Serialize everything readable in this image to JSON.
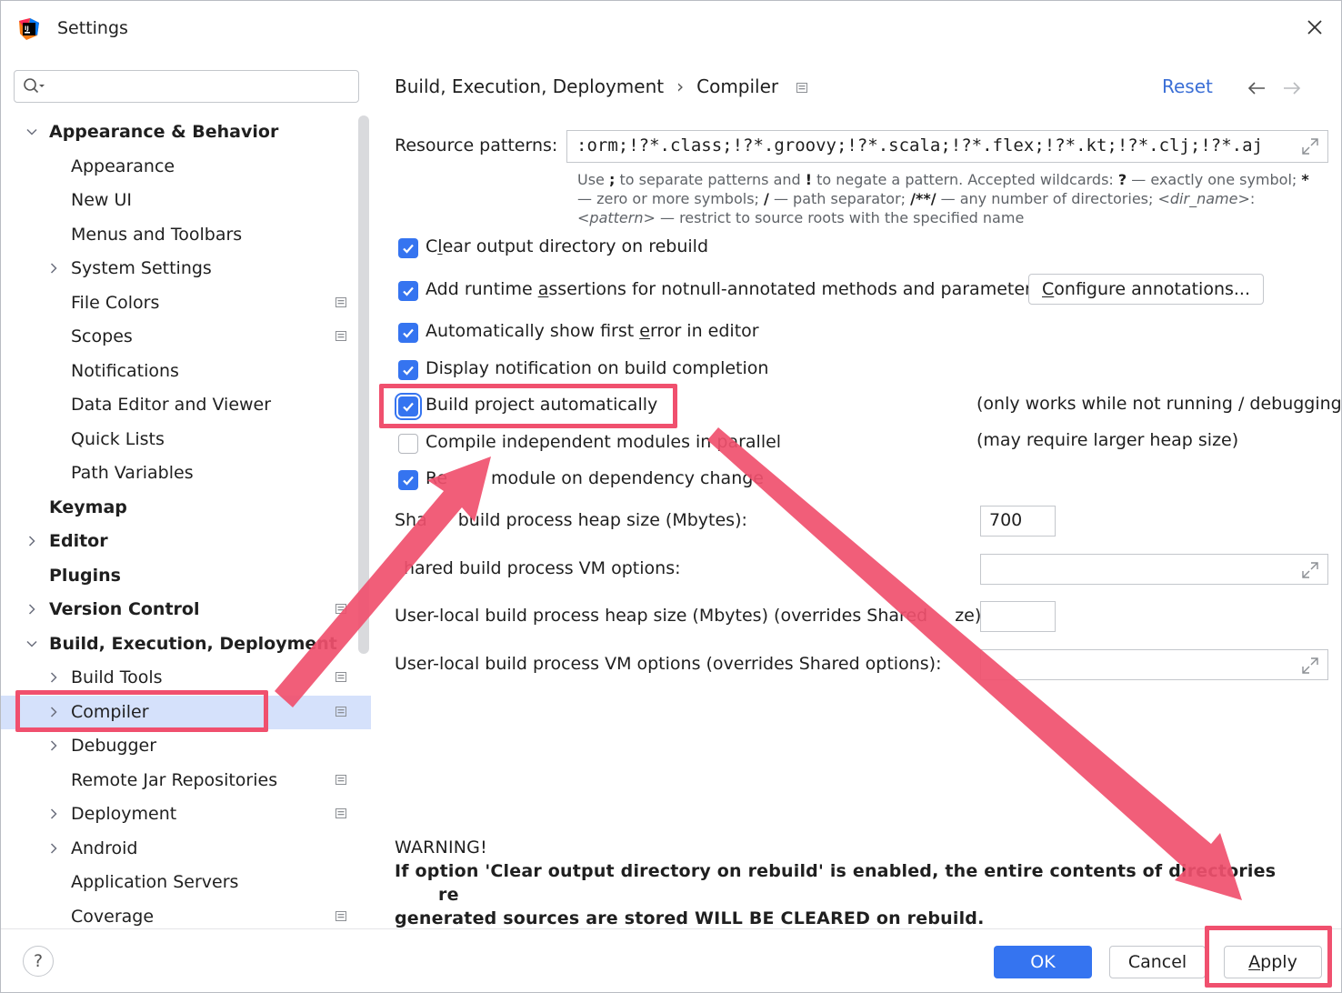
{
  "window": {
    "title": "Settings"
  },
  "search": {
    "placeholder": ""
  },
  "sidebar": {
    "items": [
      {
        "label": "Appearance & Behavior",
        "bold": true,
        "chevron": "down",
        "indent": 0,
        "project": false
      },
      {
        "label": "Appearance",
        "bold": false,
        "chevron": "none",
        "indent": 1,
        "project": false
      },
      {
        "label": "New UI",
        "bold": false,
        "chevron": "none",
        "indent": 1,
        "project": false
      },
      {
        "label": "Menus and Toolbars",
        "bold": false,
        "chevron": "none",
        "indent": 1,
        "project": false
      },
      {
        "label": "System Settings",
        "bold": false,
        "chevron": "right",
        "indent": 1,
        "project": false
      },
      {
        "label": "File Colors",
        "bold": false,
        "chevron": "none",
        "indent": 1,
        "project": true
      },
      {
        "label": "Scopes",
        "bold": false,
        "chevron": "none",
        "indent": 1,
        "project": true
      },
      {
        "label": "Notifications",
        "bold": false,
        "chevron": "none",
        "indent": 1,
        "project": false
      },
      {
        "label": "Data Editor and Viewer",
        "bold": false,
        "chevron": "none",
        "indent": 1,
        "project": false
      },
      {
        "label": "Quick Lists",
        "bold": false,
        "chevron": "none",
        "indent": 1,
        "project": false
      },
      {
        "label": "Path Variables",
        "bold": false,
        "chevron": "none",
        "indent": 1,
        "project": false
      },
      {
        "label": "Keymap",
        "bold": true,
        "chevron": "none",
        "indent": 0,
        "project": false
      },
      {
        "label": "Editor",
        "bold": true,
        "chevron": "right",
        "indent": 0,
        "project": false
      },
      {
        "label": "Plugins",
        "bold": true,
        "chevron": "none",
        "indent": 0,
        "project": false
      },
      {
        "label": "Version Control",
        "bold": true,
        "chevron": "right",
        "indent": 0,
        "project": true
      },
      {
        "label": "Build, Execution, Deployment",
        "bold": true,
        "chevron": "down",
        "indent": 0,
        "project": false
      },
      {
        "label": "Build Tools",
        "bold": false,
        "chevron": "right",
        "indent": 1,
        "project": true
      },
      {
        "label": "Compiler",
        "bold": false,
        "chevron": "right",
        "indent": 1,
        "project": true,
        "selected": true
      },
      {
        "label": "Debugger",
        "bold": false,
        "chevron": "right",
        "indent": 1,
        "project": false
      },
      {
        "label": "Remote Jar Repositories",
        "bold": false,
        "chevron": "none",
        "indent": 1,
        "project": true
      },
      {
        "label": "Deployment",
        "bold": false,
        "chevron": "right",
        "indent": 1,
        "project": true
      },
      {
        "label": "Android",
        "bold": false,
        "chevron": "right",
        "indent": 1,
        "project": false
      },
      {
        "label": "Application Servers",
        "bold": false,
        "chevron": "none",
        "indent": 1,
        "project": false
      },
      {
        "label": "Coverage",
        "bold": false,
        "chevron": "none",
        "indent": 1,
        "project": true
      }
    ]
  },
  "breadcrumb": {
    "parent": "Build, Execution, Deployment",
    "sep": "›",
    "current": "Compiler"
  },
  "header": {
    "reset": "Reset"
  },
  "resource": {
    "label": "Resource patterns:",
    "value": ":orm;!?*.class;!?*.groovy;!?*.scala;!?*.flex;!?*.kt;!?*.clj;!?*.aj",
    "hint_1": "Use ",
    "hint_2": ";",
    "hint_3": " to separate patterns and ",
    "hint_4": "!",
    "hint_5": " to negate a pattern. Accepted wildcards: ",
    "hint_6": "?",
    "hint_7": " — exactly one symbol; ",
    "hint_8": "*",
    "hint_9": " — zero or more symbols; ",
    "hint_10": "/",
    "hint_11": " — path separator; ",
    "hint_12": "/**/",
    "hint_13": " — any number of directories; ",
    "hint_14": "<dir_name>",
    "hint_15": ":",
    "hint_16": "<pattern>",
    "hint_17": " — restrict to source roots with the specified name"
  },
  "options": {
    "clear_output": {
      "label_a": "C",
      "label_u": "l",
      "label_b": "ear output directory on rebuild",
      "checked": true
    },
    "runtime_assert": {
      "label_a": "Add runtime ",
      "label_u": "a",
      "label_b": "ssertions for notnull-annotated methods and parameters",
      "checked": true
    },
    "configure_btn": {
      "label_u": "C",
      "label_b": "onfigure annotations..."
    },
    "show_first_error": {
      "label_a": "Automatically show first ",
      "label_u": "e",
      "label_b": "rror in editor",
      "checked": true
    },
    "display_notification": {
      "label": "Display notification on build completion",
      "checked": true
    },
    "build_auto": {
      "label": "Build project automatically",
      "checked": true,
      "note": "(only works while not running / debugging)"
    },
    "compile_parallel": {
      "label": "Compile independent modules in parallel",
      "checked": false,
      "note": "(may require larger heap size)"
    },
    "rebuild_module": {
      "label_a": "Re",
      "label_b": "module on dependency change",
      "checked": true
    }
  },
  "heap": {
    "shared_heap_label_a": "Sha",
    "shared_heap_label_b": "build process heap size (Mbytes):",
    "shared_heap_value": "700",
    "shared_vm_label": "hared build process VM options:",
    "local_heap_label_a": "User-local build process heap size (Mbytes) (overrides Shared ",
    "local_heap_label_b": "ze):",
    "local_vm_label": "User-local build process VM options (overrides Shared options):"
  },
  "warning": {
    "title": "WARNING!",
    "line1_a": "If option 'Clear output directory on rebuild' is enabled, the entire contents of directories",
    "line1_b": "re",
    "line2": "generated sources are stored WILL BE CLEARED on rebuild."
  },
  "footer": {
    "help": "?",
    "ok": "OK",
    "cancel": "Cancel",
    "apply_u": "A",
    "apply_rest": "pply"
  },
  "colors": {
    "accent": "#3574f0",
    "selection": "#d5e1fb",
    "annotation": "#f0506e",
    "link": "#3b6fd6"
  }
}
